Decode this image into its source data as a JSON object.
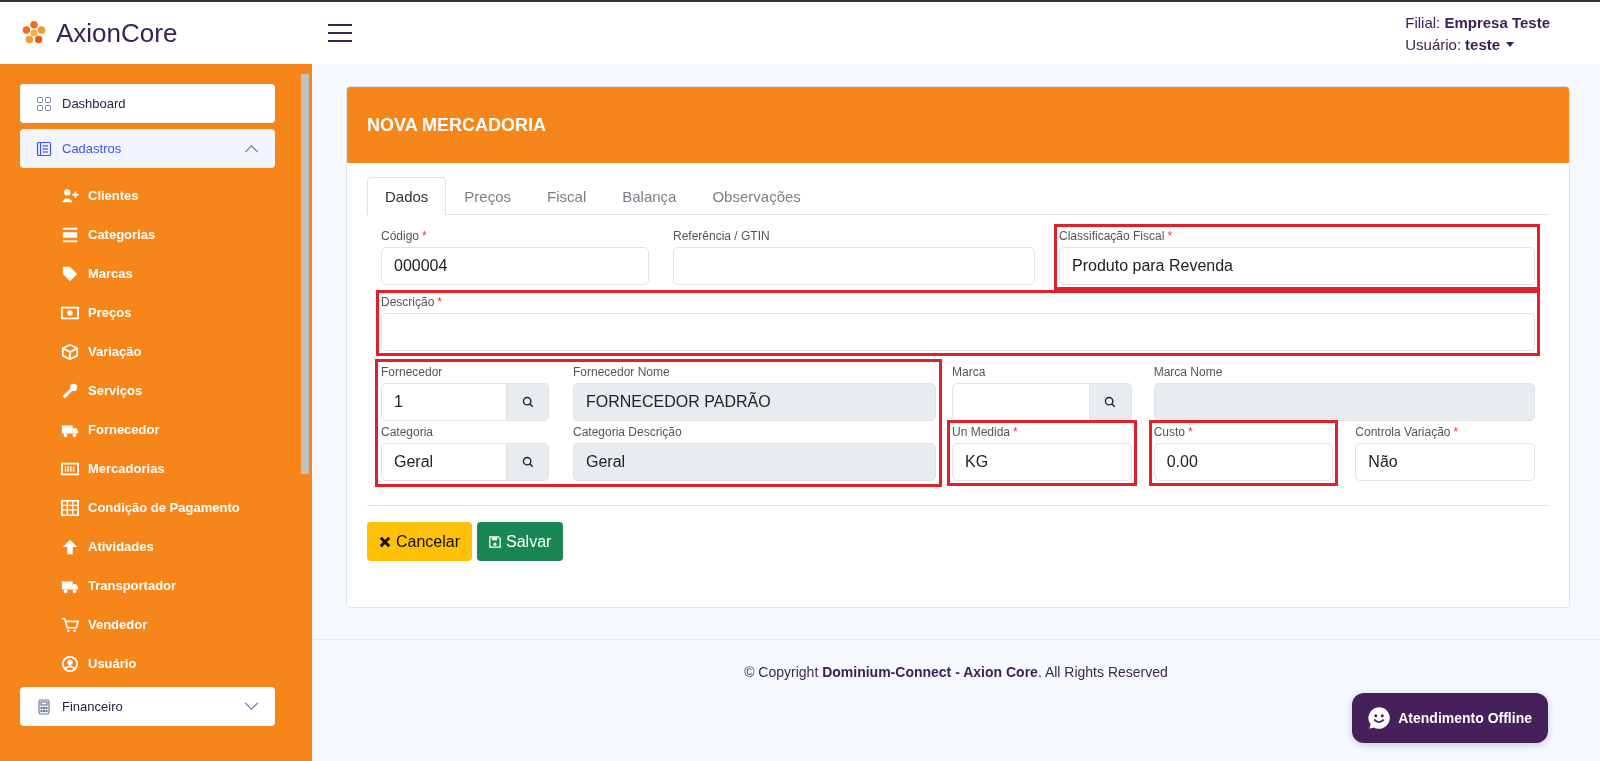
{
  "header": {
    "brand": "AxionCore",
    "branch_label": "Filial:",
    "branch": "Empresa Teste",
    "user_label": "Usuário:",
    "user": "teste"
  },
  "sidebar": {
    "items": [
      {
        "label": "Dashboard",
        "selected": false
      },
      {
        "label": "Cadastros",
        "expanded": true,
        "selected": true,
        "children": [
          {
            "label": "Clientes"
          },
          {
            "label": "Categorias"
          },
          {
            "label": "Marcas"
          },
          {
            "label": "Preços"
          },
          {
            "label": "Variação"
          },
          {
            "label": "Serviços"
          },
          {
            "label": "Fornecedor"
          },
          {
            "label": "Mercadorias"
          },
          {
            "label": "Condição de Pagamento"
          },
          {
            "label": "Atividades"
          },
          {
            "label": "Transportador"
          },
          {
            "label": "Vendedor"
          },
          {
            "label": "Usuário"
          }
        ]
      },
      {
        "label": "Financeiro",
        "expanded": false,
        "selected": false
      }
    ]
  },
  "card": {
    "title": "NOVA MERCADORIA"
  },
  "tabs": [
    {
      "label": "Dados",
      "selected": true
    },
    {
      "label": "Preços",
      "selected": false
    },
    {
      "label": "Fiscal",
      "selected": false
    },
    {
      "label": "Balança",
      "selected": false
    },
    {
      "label": "Observações",
      "selected": false
    }
  ],
  "form": {
    "top_fields": [
      {
        "label": "Código",
        "required_mark": "*",
        "value": "000004",
        "highlighted": false
      },
      {
        "label": "Referência / GTIN",
        "highlighted": false
      },
      {
        "label": "Classificação Fiscal",
        "required_mark": "*",
        "value": "Produto para Revenda",
        "highlighted": true
      }
    ],
    "description": {
      "label": "Descrição",
      "required_mark": "*",
      "highlighted": true
    },
    "lookup_block": {
      "highlighted": true,
      "fields": [
        {
          "label": "Fornecedor",
          "value": "1",
          "kind": "lookup"
        },
        {
          "label": "Fornecedor Nome",
          "value": "FORNECEDOR PADRÃO",
          "kind": "readonly"
        },
        {
          "label": "Categoria",
          "value": "Geral",
          "kind": "lookup"
        },
        {
          "label": "Categoria Descrição",
          "value": "Geral",
          "kind": "readonly"
        }
      ]
    },
    "right_fields": [
      {
        "label": "Marca",
        "kind": "lookup",
        "highlighted": false
      },
      {
        "label": "Marca Nome",
        "kind": "readonly",
        "highlighted": false
      },
      {
        "label": "Un Medida",
        "required_mark": "*",
        "value": "KG",
        "kind": "text",
        "highlighted": true
      },
      {
        "label": "Custo",
        "required_mark": "*",
        "value": "0.00",
        "kind": "text",
        "highlighted": true
      },
      {
        "label": "Controla Variação",
        "required_mark": "*",
        "value": "Não",
        "kind": "text",
        "highlighted": false
      }
    ]
  },
  "buttons": [
    {
      "label": "Cancelar",
      "kind": "cancel"
    },
    {
      "label": "Salvar",
      "kind": "save"
    }
  ],
  "footer": {
    "prefix": "© Copyright",
    "company": "Dominium-Connect - Axion Core",
    "suffix": ". All Rights Reserved"
  },
  "chat_button": {
    "label": "Atendimento Offline"
  }
}
